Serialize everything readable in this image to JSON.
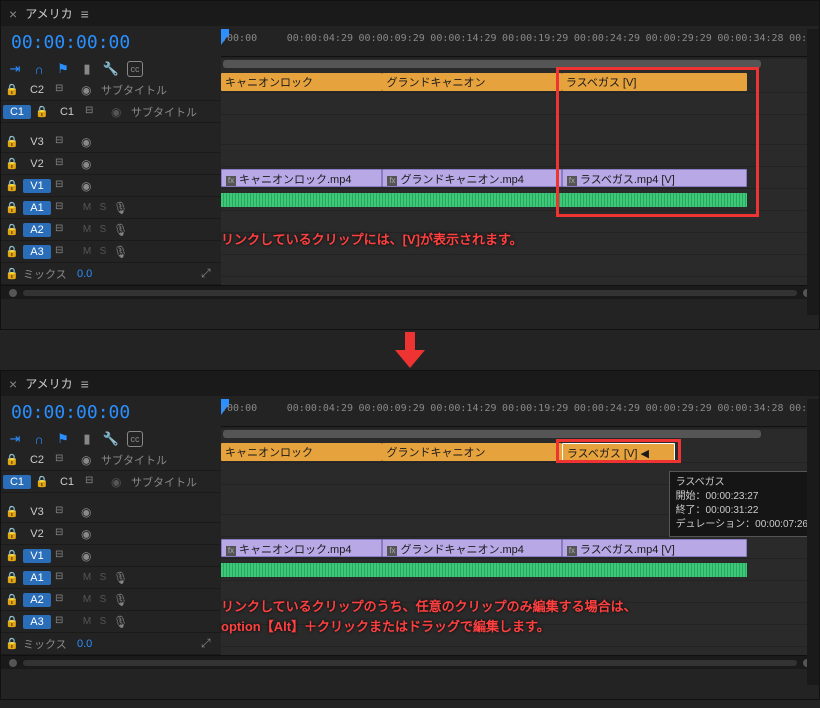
{
  "sequence_name": "アメリカ",
  "timecode": "00:00:00:00",
  "ruler": [
    ":00:00",
    "00:00:04:29",
    "00:00:09:29",
    "00:00:14:29",
    "00:00:19:29",
    "00:00:24:29",
    "00:00:29:29",
    "00:00:34:28",
    "00:0"
  ],
  "tracks": {
    "c2": "C2",
    "c1_left": "C1",
    "c1": "C1",
    "v3": "V3",
    "v2": "V2",
    "v1": "V1",
    "a1": "A1",
    "a2": "A2",
    "a3": "A3",
    "subtitle": "サブタイトル",
    "mix": "ミックス",
    "mix_val": "0.0",
    "m": "M",
    "s": "S"
  },
  "clips": {
    "canyon_rock": "キャニオンロック",
    "grand_canyon": "グランドキャニオン",
    "las_vegas": "ラスベガス [V]",
    "canyon_rock_mp4": "キャニオンロック.mp4",
    "grand_canyon_mp4": "グランドキャニオン.mp4",
    "las_vegas_mp4": "ラスベガス.mp4 [V]",
    "las_vegas_trimmed": "ラスベガス [V]"
  },
  "annotation1": "リンクしているクリップには、[V]が表示されます。",
  "annotation2a": "リンクしているクリップのうち、任意のクリップのみ編集する場合は、",
  "annotation2b": "option【Alt】＋クリックまたはドラッグで編集します。",
  "tooltip": {
    "name": "ラスベガス",
    "start": "開始：00:00:23:27",
    "end": "終了：00:00:31:22",
    "dur": "デュレーション：00:00:07:26"
  }
}
